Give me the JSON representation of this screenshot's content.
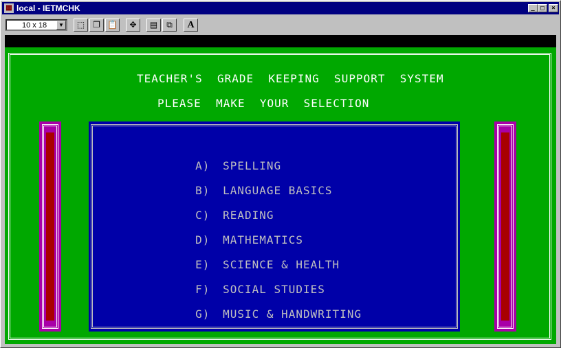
{
  "window": {
    "title": "local - IETMCHK",
    "controls": [
      "minimize",
      "maximize",
      "close"
    ]
  },
  "toolbar": {
    "font_size_value": "10 x 18",
    "buttons": [
      "mark-icon",
      "copy-icon",
      "paste-icon",
      "fullscreen-icon",
      "properties-icon",
      "background-icon",
      "font-icon"
    ],
    "font_button_label": "A"
  },
  "screen": {
    "heading": "TEACHER'S  GRADE  KEEPING  SUPPORT  SYSTEM",
    "prompt": "PLEASE  MAKE  YOUR  SELECTION",
    "menu": [
      {
        "key": "A)",
        "label": "SPELLING"
      },
      {
        "key": "B)",
        "label": "LANGUAGE BASICS"
      },
      {
        "key": "C)",
        "label": "READING"
      },
      {
        "key": "D)",
        "label": "MATHEMATICS"
      },
      {
        "key": "E)",
        "label": "SCIENCE & HEALTH"
      },
      {
        "key": "F)",
        "label": "SOCIAL STUDIES"
      },
      {
        "key": "G)",
        "label": "MUSIC & HANDWRITING"
      }
    ]
  },
  "colors": {
    "background": "#00a800",
    "menu_panel": "#0000a8",
    "pillar": "#a800a8",
    "pillar_core": "#a80000",
    "title_bar": "#000080"
  }
}
